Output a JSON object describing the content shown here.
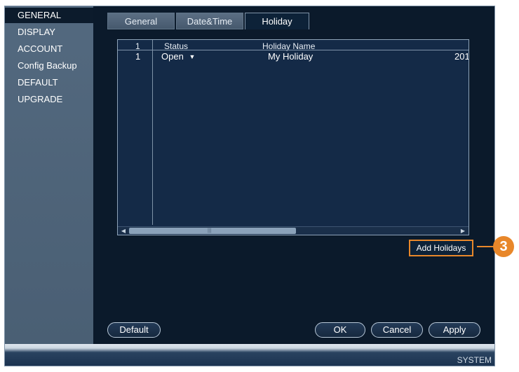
{
  "sidebar": {
    "items": [
      {
        "label": "GENERAL",
        "active": true
      },
      {
        "label": "DISPLAY"
      },
      {
        "label": "ACCOUNT"
      },
      {
        "label": "Config Backup"
      },
      {
        "label": "DEFAULT"
      },
      {
        "label": "UPGRADE"
      }
    ]
  },
  "tabs": [
    {
      "label": "General"
    },
    {
      "label": "Date&Time"
    },
    {
      "label": "Holiday",
      "active": true
    }
  ],
  "table": {
    "headers": [
      "1",
      "Status",
      "Holiday Name"
    ],
    "rows": [
      {
        "index": "1",
        "status": "Open",
        "name": "My Holiday",
        "date": "201"
      }
    ]
  },
  "add_holidays_label": "Add Holidays",
  "buttons": {
    "default": "Default",
    "ok": "OK",
    "cancel": "Cancel",
    "apply": "Apply"
  },
  "statusbar": {
    "label": "SYSTEM"
  },
  "callout": {
    "number": "3",
    "color": "#e8872a"
  },
  "colors": {
    "background": "#0b1a2b",
    "sidebar": "#4f657a",
    "table": "#142a47",
    "highlight": "#e8872a"
  }
}
